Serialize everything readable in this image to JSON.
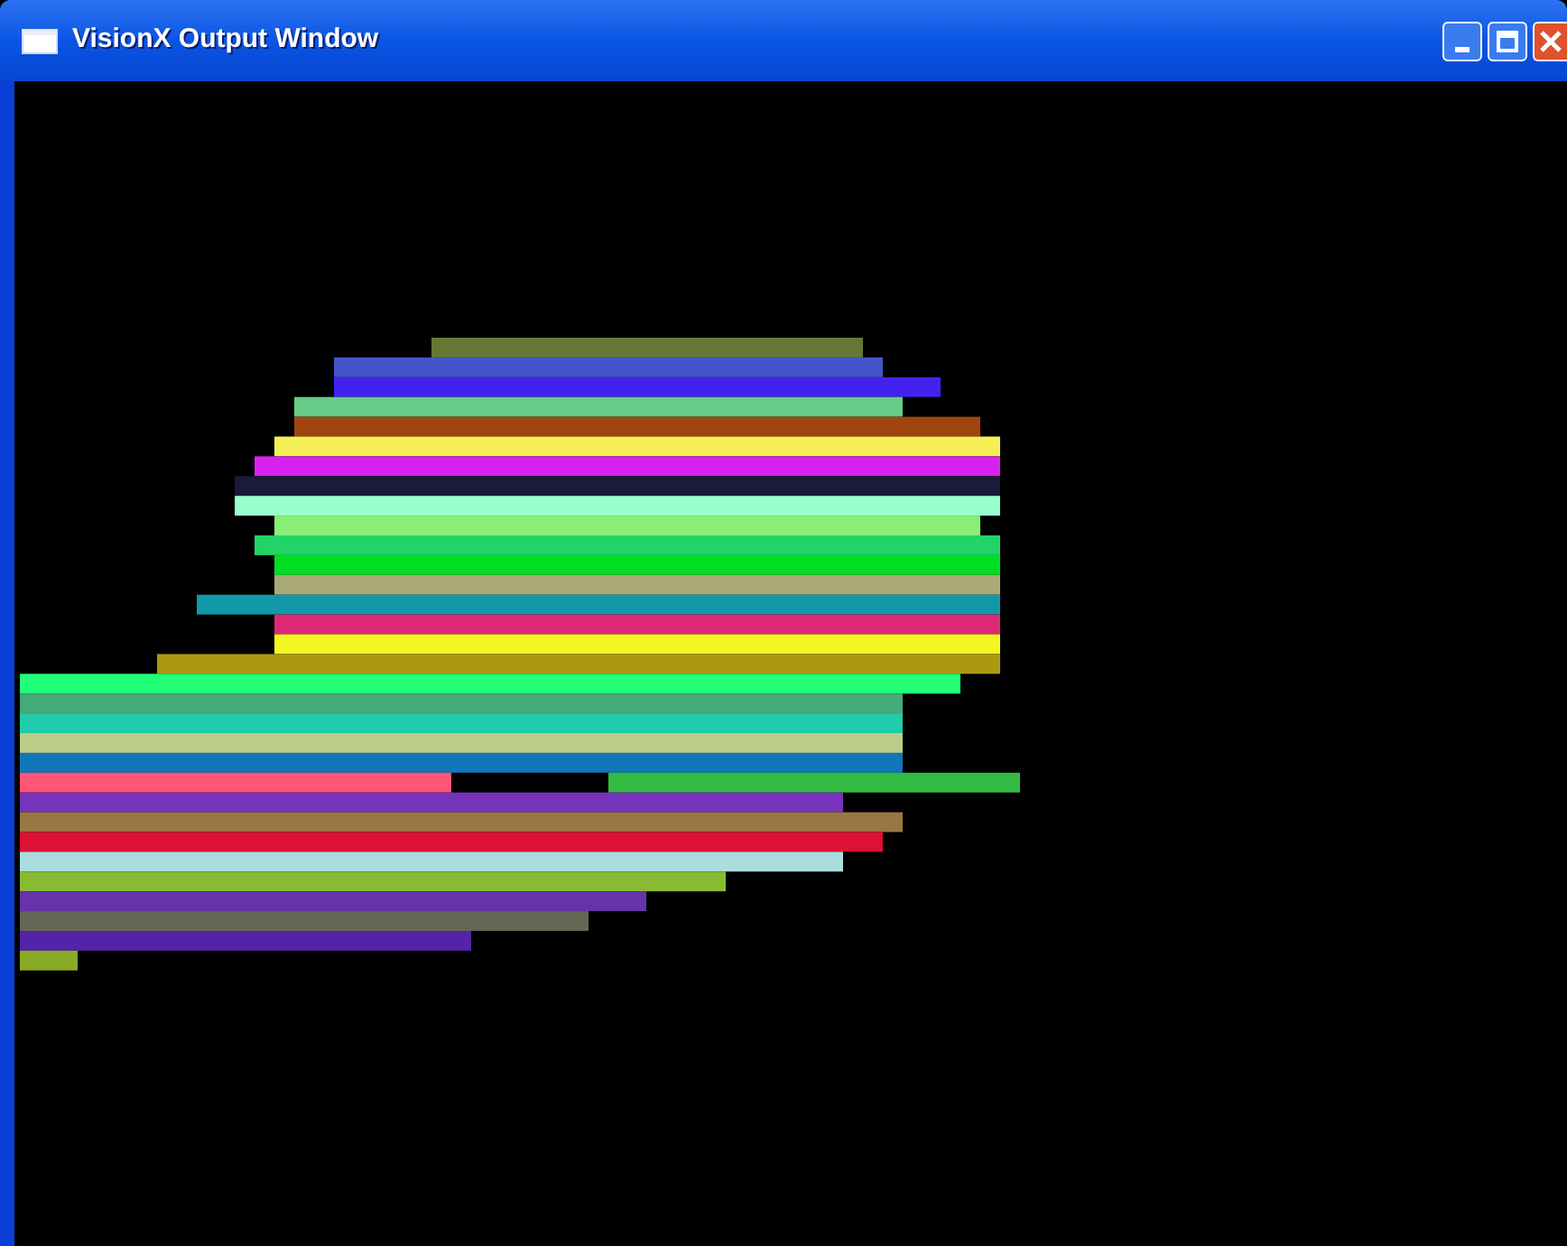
{
  "window": {
    "title": "VisionX Output Window"
  }
}
